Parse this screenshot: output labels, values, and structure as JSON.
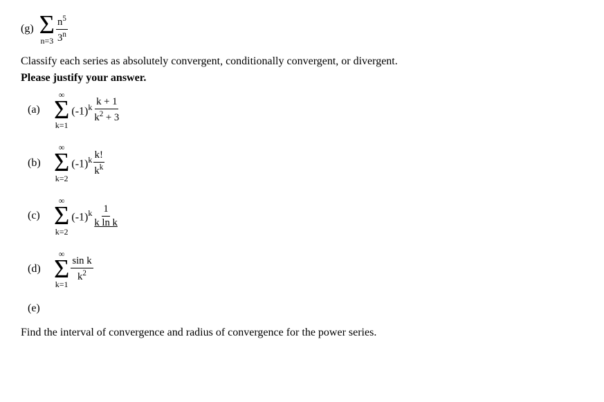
{
  "top": {
    "label": "(g)",
    "sigma_sup": "n⁵",
    "sigma_sub": "n=3",
    "sigma_char": "Σ",
    "fraction_num": "n⁵",
    "fraction_den": "3ⁿ",
    "index_start": "n=3"
  },
  "classify_line1": "Classify each series as absolutely convergent, conditionally convergent, or divergent.",
  "classify_line2": "Please justify your answer.",
  "problems": [
    {
      "id": "a",
      "label": "(a)",
      "sigma_sup": "∞",
      "sigma_sub": "k=1",
      "base": "(-1)",
      "exp": "k",
      "frac_num": "k + 1",
      "frac_den": "k² + 3"
    },
    {
      "id": "b",
      "label": "(b)",
      "sigma_sup": "∞",
      "sigma_sub": "k=2",
      "base": "(-1)",
      "exp": "k",
      "frac_num": "k!",
      "frac_den": "kᵏ"
    },
    {
      "id": "c",
      "label": "(c)",
      "sigma_sup": "∞",
      "sigma_sub": "k=2",
      "base": "(-1)",
      "exp": "k",
      "frac_num": "1",
      "frac_den": "k ln k"
    },
    {
      "id": "d",
      "label": "(d)",
      "sigma_sup": "∞",
      "sigma_sub": "k=1",
      "base": "",
      "exp": "",
      "frac_num": "sin k",
      "frac_den": "k²"
    },
    {
      "id": "e",
      "label": "(e)",
      "empty": true
    }
  ],
  "find_text": "Find the interval of convergence and radius of convergence for the power series."
}
